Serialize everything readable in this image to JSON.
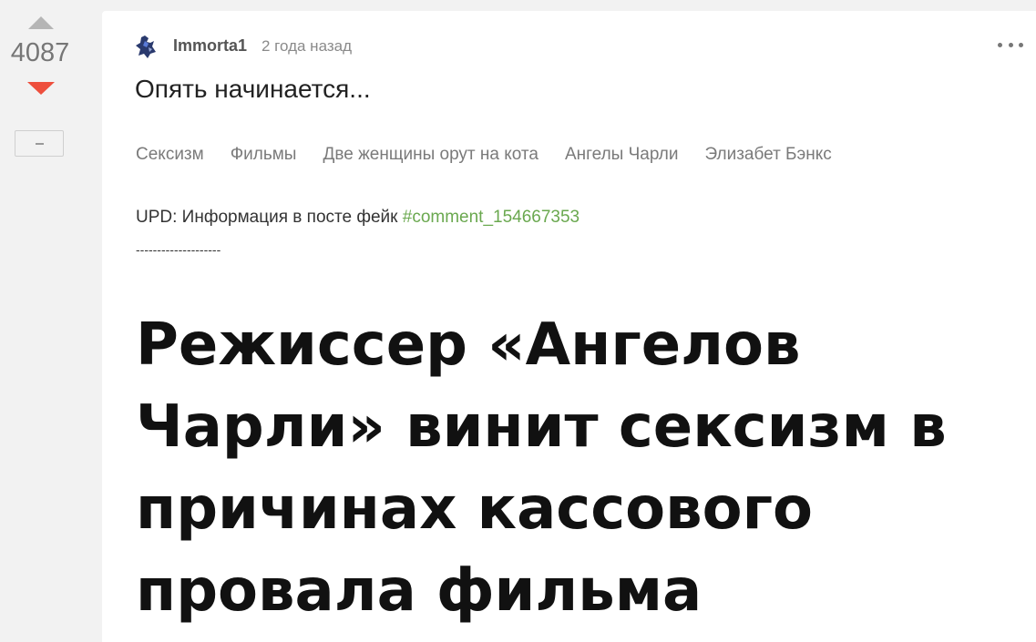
{
  "vote": {
    "rating": "4087",
    "up_icon": "triangle-up-icon",
    "down_icon": "triangle-down-icon",
    "down_color": "#ee4f3d",
    "collapse_icon": "minus-icon"
  },
  "post": {
    "author": "Immorta1",
    "time": "2 года назад",
    "more_icon": "ellipsis-icon",
    "title": "Опять начинается...",
    "tags": [
      "Сексизм",
      "Фильмы",
      "Две женщины орут на кота",
      "Ангелы Чарли",
      "Элизабет Бэнкс"
    ],
    "upd_prefix": "UPD: Информация в посте фейк ",
    "upd_link": "#comment_154667353",
    "link_color": "#6aa84f",
    "divider": "--------------------",
    "headline_lines": [
      "Режиссер «Ангелов",
      "Чарли» винит сексизм в",
      "причинах кассового",
      "провала фильма"
    ]
  }
}
